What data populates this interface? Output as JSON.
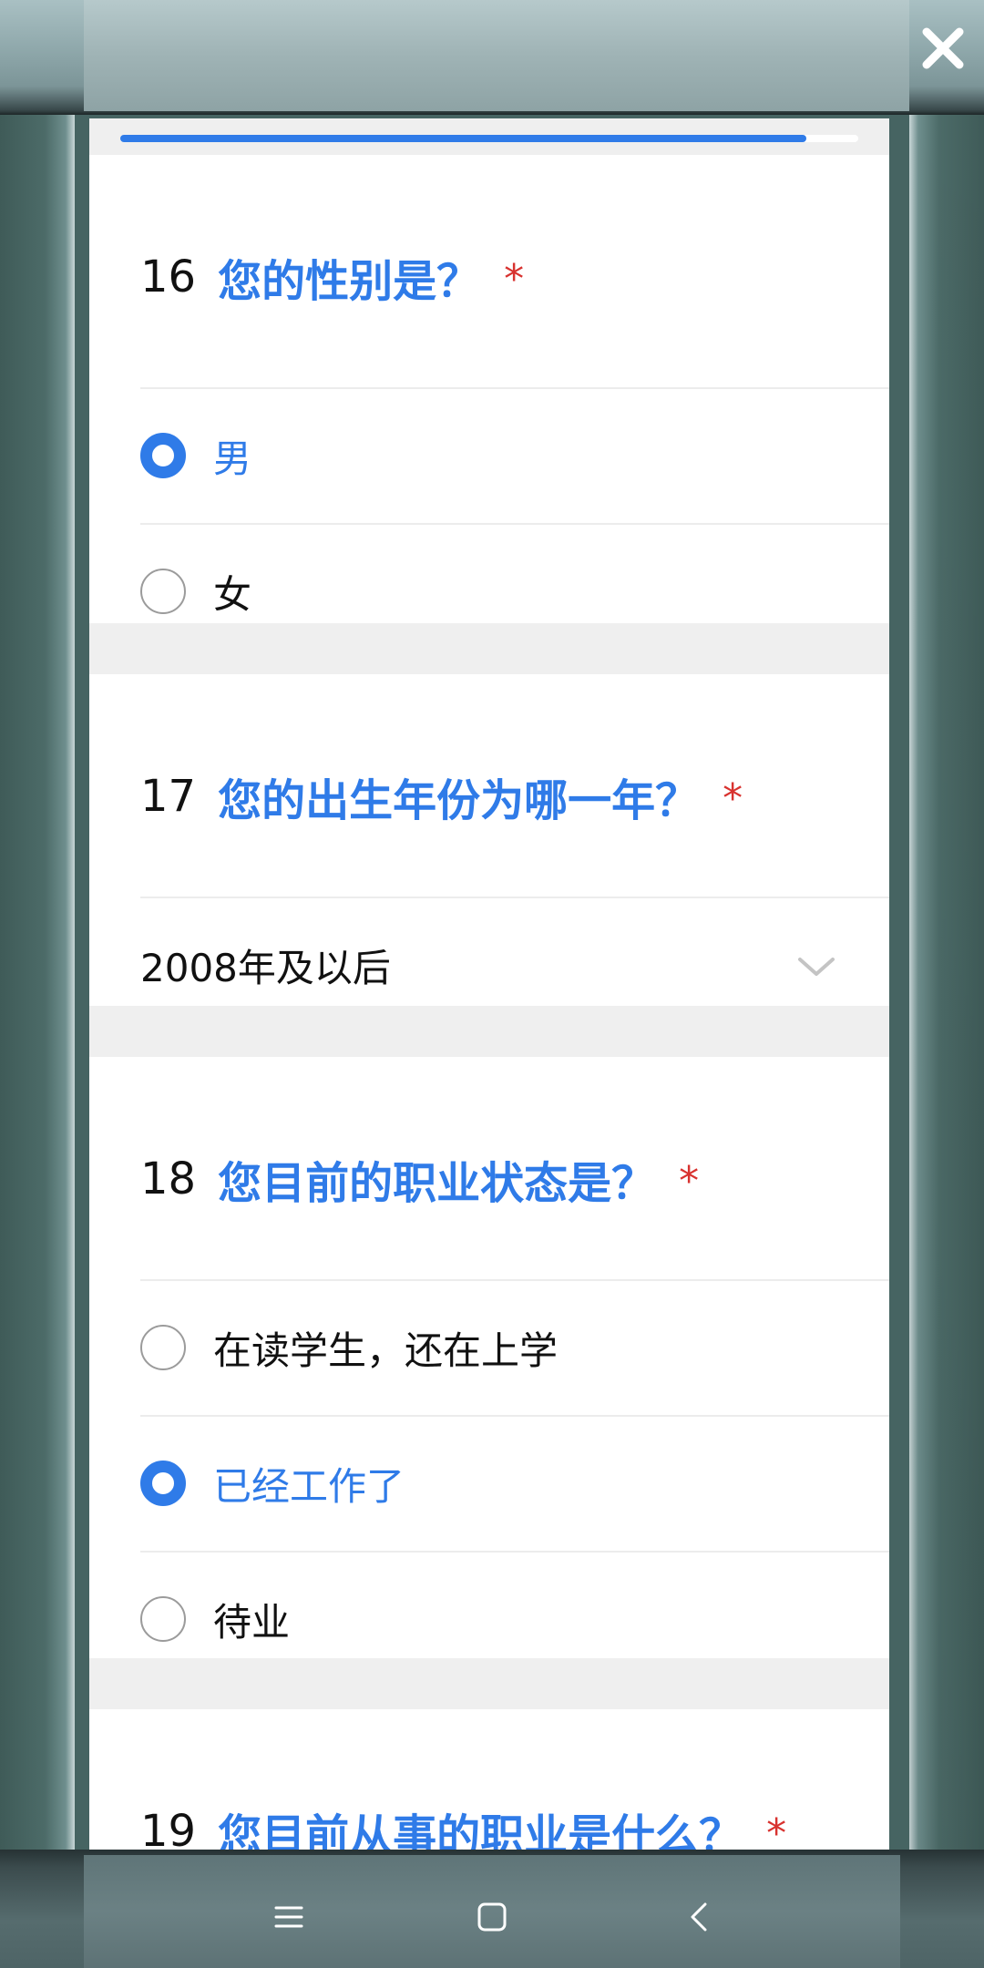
{
  "progress": {
    "fraction": 0.93
  },
  "questions": [
    {
      "number": "16",
      "title": "您的性别是？",
      "required_mark": "*",
      "options": [
        {
          "label": "男",
          "selected": true
        },
        {
          "label": "女",
          "selected": false
        }
      ]
    },
    {
      "number": "17",
      "title": "您的出生年份为哪一年？",
      "required_mark": "*",
      "select_value": "2008年及以后"
    },
    {
      "number": "18",
      "title": "您目前的职业状态是？",
      "required_mark": "*",
      "options": [
        {
          "label": "在读学生，还在上学",
          "selected": false
        },
        {
          "label": "已经工作了",
          "selected": true
        },
        {
          "label": "待业",
          "selected": false
        }
      ]
    },
    {
      "number": "19",
      "title": "您目前从事的职业是什么？",
      "required_mark": "*"
    }
  ],
  "colors": {
    "accent": "#2f7be8",
    "required": "#d8322f"
  },
  "icons": {
    "close": "close-icon",
    "nav_menu": "menu-icon",
    "nav_home": "home-square-icon",
    "nav_back": "back-chevron-icon",
    "select": "chevron-down-icon"
  }
}
